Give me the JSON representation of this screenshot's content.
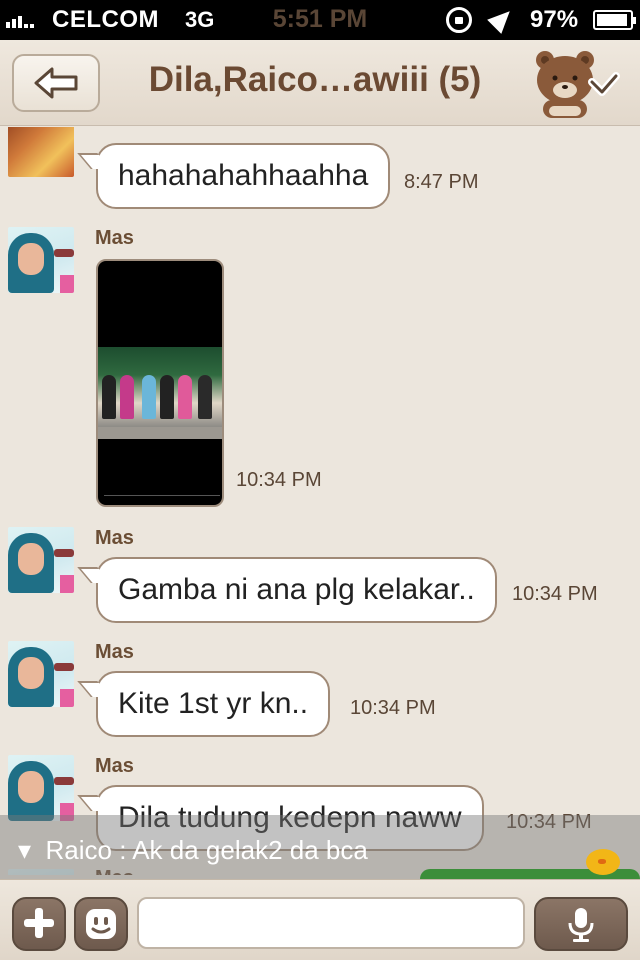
{
  "status_bar": {
    "carrier": "CELCOM",
    "network": "3G",
    "time": "5:51 PM",
    "battery": "97%"
  },
  "header": {
    "title": "Dila,Raico…awiii (5)"
  },
  "messages": [
    {
      "sender": "",
      "text": "hahahahahhaahha",
      "time": "8:47 PM"
    },
    {
      "sender": "Mas",
      "type": "photo",
      "time": "10:34 PM"
    },
    {
      "sender": "Mas",
      "text": "Gamba ni ana plg kelakar..",
      "time": "10:34 PM"
    },
    {
      "sender": "Mas",
      "text": "Kite 1st yr kn..",
      "time": "10:34 PM"
    },
    {
      "sender": "Mas",
      "text": "Dila tudung kedepn naww",
      "time": "10:34 PM"
    },
    {
      "sender": "Mas"
    }
  ],
  "notification_banner": {
    "text": "Raico  :  Ak da gelak2 da bca"
  },
  "input_bar": {
    "placeholder": ""
  }
}
